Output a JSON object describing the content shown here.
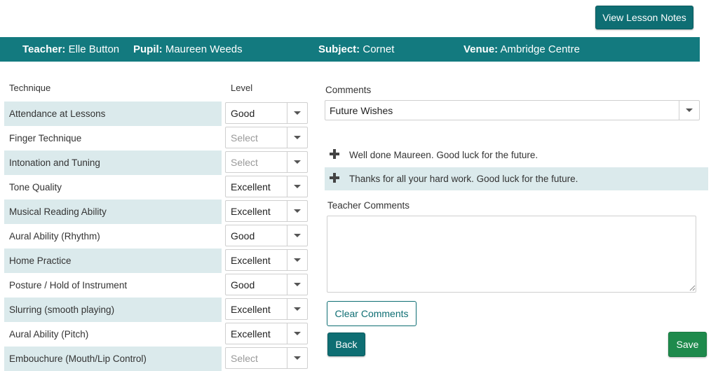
{
  "header": {
    "view_notes_label": "View Lesson Notes"
  },
  "info": {
    "teacher_label": "Teacher:",
    "teacher_value": "Elle Button",
    "pupil_label": "Pupil:",
    "pupil_value": "Maureen Weeds",
    "subject_label": "Subject:",
    "subject_value": "Cornet",
    "venue_label": "Venue:",
    "venue_value": "Ambridge Centre"
  },
  "table": {
    "col_technique": "Technique",
    "col_level": "Level",
    "rows": [
      {
        "technique": "Attendance at Lessons",
        "level": "Good"
      },
      {
        "technique": "Finger Technique",
        "level": "Select"
      },
      {
        "technique": "Intonation and Tuning",
        "level": "Select"
      },
      {
        "technique": "Tone Quality",
        "level": "Excellent"
      },
      {
        "technique": "Musical Reading Ability",
        "level": "Excellent"
      },
      {
        "technique": "Aural Ability (Rhythm)",
        "level": "Good"
      },
      {
        "technique": "Home Practice",
        "level": "Excellent"
      },
      {
        "technique": "Posture / Hold of Instrument",
        "level": "Good"
      },
      {
        "technique": "Slurring (smooth playing)",
        "level": "Excellent"
      },
      {
        "technique": "Aural Ability (Pitch)",
        "level": "Excellent"
      },
      {
        "technique": "Embouchure (Mouth/Lip Control)",
        "level": "Select"
      }
    ]
  },
  "comments": {
    "label": "Comments",
    "category_selected": "Future Wishes",
    "items": [
      "Well done Maureen. Good luck for the future.",
      "Thanks for all your hard work. Good luck for the future."
    ],
    "teacher_label": "Teacher Comments",
    "teacher_value": ""
  },
  "actions": {
    "clear_label": "Clear Comments",
    "back_label": "Back",
    "save_label": "Save"
  },
  "colors": {
    "teal": "#137a7f",
    "row_shade": "#dbeaec",
    "save_green": "#1e8a4c"
  }
}
